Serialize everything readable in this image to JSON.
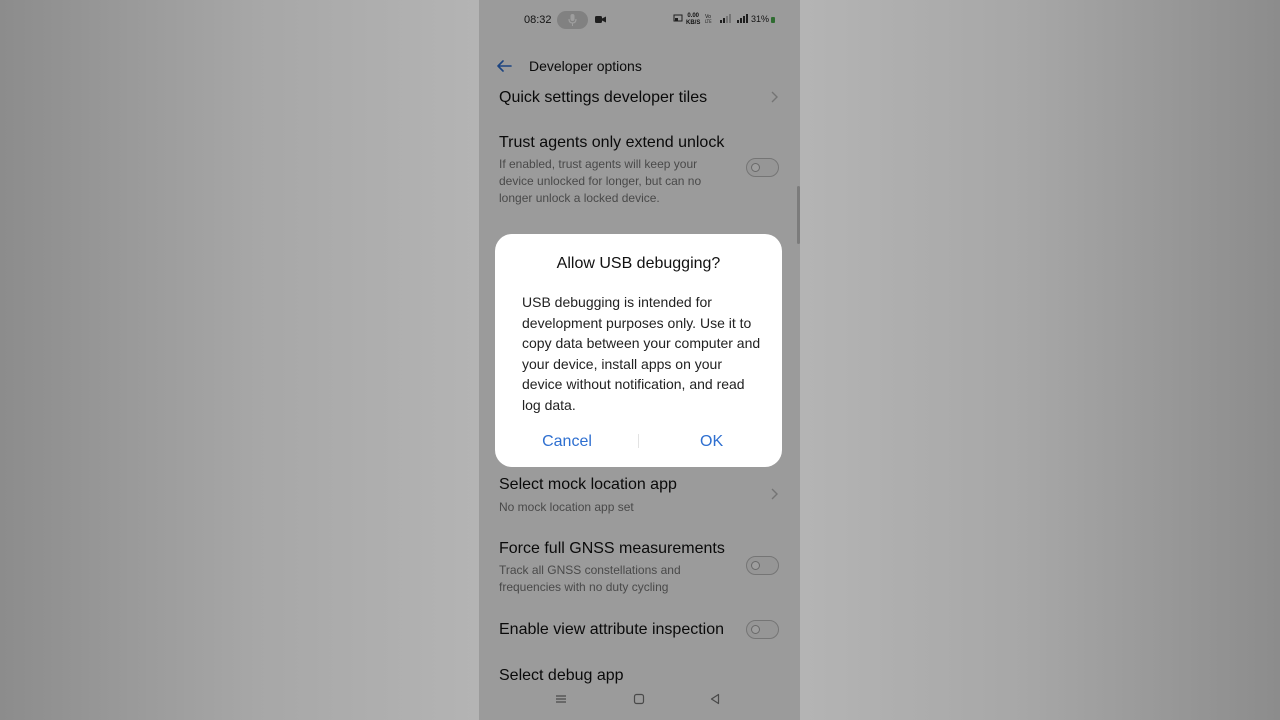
{
  "status_bar": {
    "time": "08:32",
    "net_speed_top": "0.00",
    "net_speed_bottom": "KB/S",
    "battery": "31%"
  },
  "header": {
    "title": "Developer options"
  },
  "settings": {
    "quick_settings_tiles": "Quick settings developer tiles",
    "trust_agents_title": "Trust agents only extend unlock",
    "trust_agents_sub": "If enabled, trust agents will keep your device unlocked for longer, but can no longer unlock a locked device.",
    "mock_location_title": "Select mock location app",
    "mock_location_sub": "No mock location app set",
    "gnss_title": "Force full GNSS measurements",
    "gnss_sub": "Track all GNSS constellations and frequencies with no duty cycling",
    "view_attr_title": "Enable view attribute inspection",
    "debug_app_title": "Select debug app"
  },
  "dialog": {
    "title": "Allow USB debugging?",
    "body": "USB debugging is intended for development purposes only. Use it to copy data between your computer and your device, install apps on your device without notification, and read log data.",
    "cancel_label": "Cancel",
    "ok_label": "OK"
  },
  "colors": {
    "accent": "#2e6fd0",
    "battery_indicator": "#4caf50"
  }
}
